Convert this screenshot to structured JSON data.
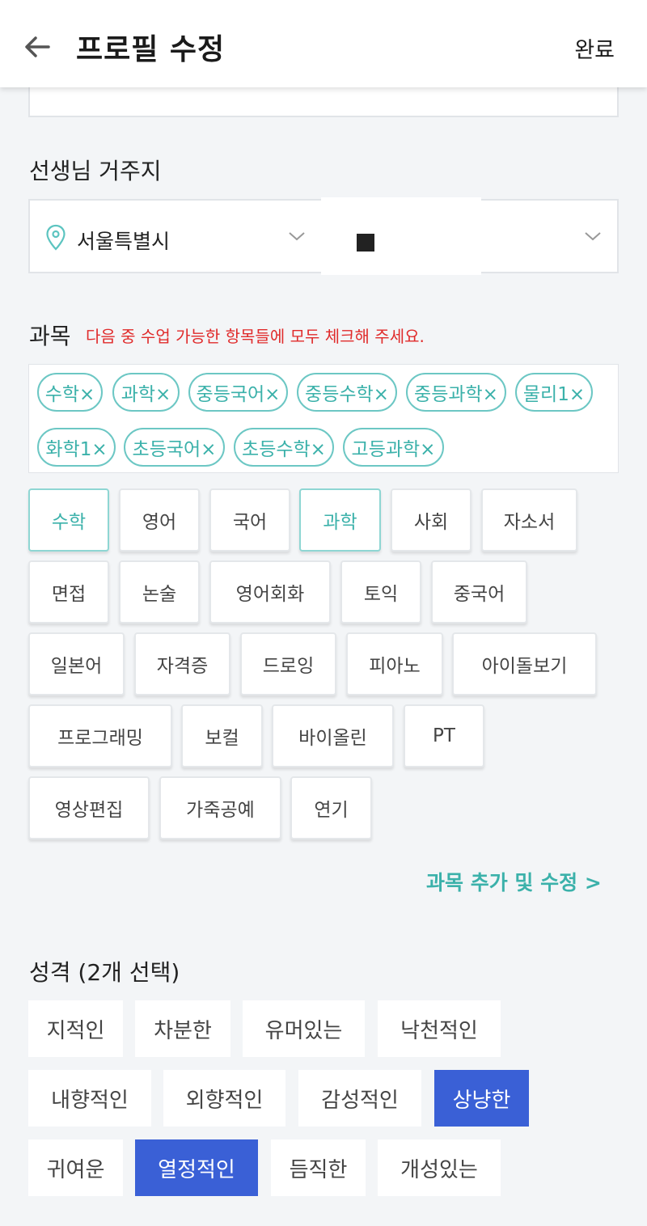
{
  "header": {
    "title": "프로필 수정",
    "done_label": "완료"
  },
  "residence": {
    "label": "선생님 거주지",
    "city": "서울특별시"
  },
  "subjects": {
    "label": "과목",
    "hint": "다음 중 수업 가능한 항목들에 모두 체크해 주세요.",
    "selected_chips": [
      "수학×",
      "과학×",
      "중등국어×",
      "중등수학×",
      "중등과학×",
      "물리1×",
      "화학1×",
      "초등국어×",
      "초등수학×",
      "고등과학×"
    ],
    "options": [
      {
        "label": "수학",
        "selected": true
      },
      {
        "label": "영어",
        "selected": false
      },
      {
        "label": "국어",
        "selected": false
      },
      {
        "label": "과학",
        "selected": true
      },
      {
        "label": "사회",
        "selected": false
      },
      {
        "label": "자소서",
        "selected": false
      },
      {
        "label": "면접",
        "selected": false
      },
      {
        "label": "논술",
        "selected": false
      },
      {
        "label": "영어회화",
        "selected": false
      },
      {
        "label": "토익",
        "selected": false
      },
      {
        "label": "중국어",
        "selected": false
      },
      {
        "label": "일본어",
        "selected": false
      },
      {
        "label": "자격증",
        "selected": false
      },
      {
        "label": "드로잉",
        "selected": false
      },
      {
        "label": "피아노",
        "selected": false
      },
      {
        "label": "아이돌보기",
        "selected": false
      },
      {
        "label": "프로그래밍",
        "selected": false
      },
      {
        "label": "보컬",
        "selected": false
      },
      {
        "label": "바이올린",
        "selected": false
      },
      {
        "label": "PT",
        "selected": false
      },
      {
        "label": "영상편집",
        "selected": false
      },
      {
        "label": "가죽공예",
        "selected": false
      },
      {
        "label": "연기",
        "selected": false
      }
    ],
    "add_link": "과목 추가 및 수정 >"
  },
  "personality": {
    "label": "성격 (2개 선택)",
    "options": [
      {
        "label": "지적인",
        "selected": false
      },
      {
        "label": "차분한",
        "selected": false
      },
      {
        "label": "유머있는",
        "selected": false
      },
      {
        "label": "낙천적인",
        "selected": false
      },
      {
        "label": "내향적인",
        "selected": false
      },
      {
        "label": "외향적인",
        "selected": false
      },
      {
        "label": "감성적인",
        "selected": false
      },
      {
        "label": "상냥한",
        "selected": true
      },
      {
        "label": "귀여운",
        "selected": false
      },
      {
        "label": "열정적인",
        "selected": true
      },
      {
        "label": "듬직한",
        "selected": false
      },
      {
        "label": "개성있는",
        "selected": false
      }
    ]
  },
  "colors": {
    "accent_teal": "#3bb1aa",
    "selected_blue": "#3a60d6",
    "hint_red": "#e02b2b"
  },
  "icons": [
    "back-arrow-icon",
    "location-pin-icon",
    "chevron-down-icon"
  ]
}
